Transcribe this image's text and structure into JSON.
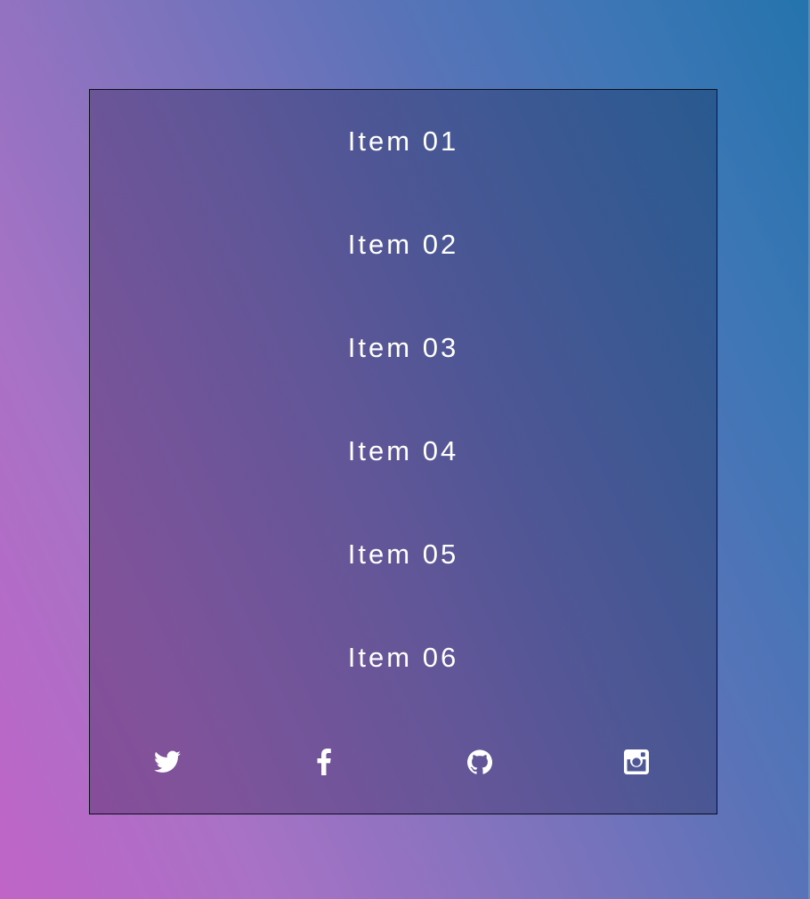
{
  "menu": {
    "items": [
      {
        "label": "Item 01"
      },
      {
        "label": "Item 02"
      },
      {
        "label": "Item 03"
      },
      {
        "label": "Item 04"
      },
      {
        "label": "Item 05"
      },
      {
        "label": "Item 06"
      }
    ]
  },
  "social": {
    "links": [
      {
        "icon": "twitter-icon"
      },
      {
        "icon": "facebook-icon"
      },
      {
        "icon": "github-icon"
      },
      {
        "icon": "instagram-icon"
      }
    ]
  },
  "colors": {
    "text": "#ffffff",
    "panel_border": "#0a0e1a",
    "gradient_start": "#c064c8",
    "gradient_end": "#2474ad"
  }
}
